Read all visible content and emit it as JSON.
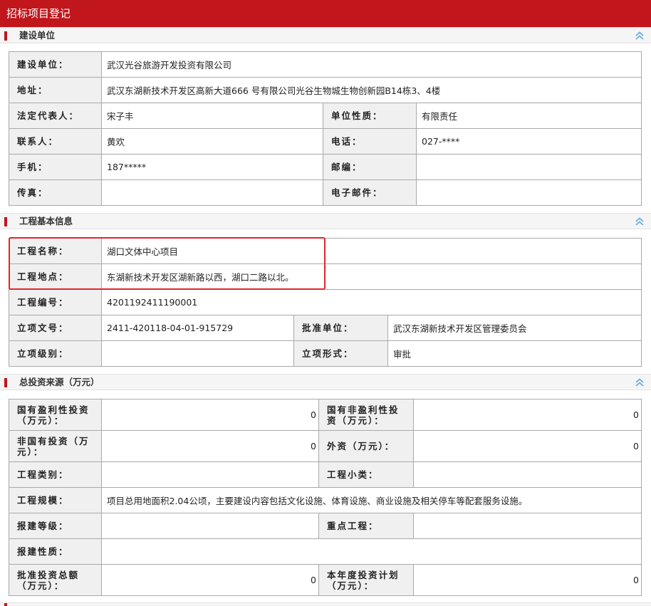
{
  "window": {
    "title": "招标项目登记"
  },
  "sections": {
    "builder": {
      "title": "建设单位",
      "rows": {
        "unit_label": "建设单位：",
        "unit_value": "武汉光谷旅游开发投资有限公司",
        "address_label": "地址：",
        "address_value": "武汉东湖新技术开发区高新大道666 号有限公司光谷生物城生物创新园B14栋3、4楼",
        "legal_rep_label": "法定代表人：",
        "legal_rep_value": "宋子丰",
        "unit_nature_label": "单位性质：",
        "unit_nature_value": "有限责任",
        "contact_label": "联系人：",
        "contact_value": "黄欢",
        "phone_label": "电话：",
        "phone_value": "027-****",
        "mobile_label": "手机：",
        "mobile_value": "187*****",
        "postcode_label": "邮编：",
        "postcode_value": "",
        "fax_label": "传真：",
        "fax_value": "",
        "email_label": "电子邮件：",
        "email_value": ""
      }
    },
    "project": {
      "title": "工程基本信息",
      "rows": {
        "name_label": "工程名称：",
        "name_value": "湖口文体中心项目",
        "location_label": "工程地点：",
        "location_value": "东湖新技术开发区湖新路以西，湖口二路以北。",
        "code_label": "工程编号：",
        "code_value": "4201192411190001",
        "doc_label": "立项文号：",
        "doc_value": "2411-420118-04-01-915729",
        "approver_label": "批准单位：",
        "approver_value": "武汉东湖新技术开发区管理委员会",
        "level_label": "立项级别：",
        "level_value": "",
        "form_label": "立项形式：",
        "form_value": "审批"
      }
    },
    "investment": {
      "title": "总投资来源（万元）",
      "rows": {
        "state_profit_label": "国有盈利性投资（万元）：",
        "state_profit_value": "0",
        "state_nonprofit_label": "国有非盈利性投资（万元）：",
        "state_nonprofit_value": "0",
        "nonstate_label": "非国有投资（万元）：",
        "nonstate_value": "0",
        "foreign_label": "外资（万元）：",
        "foreign_value": "0",
        "category_label": "工程类别：",
        "category_value": "",
        "subcategory_label": "工程小类：",
        "subcategory_value": "",
        "scale_label": "工程规模：",
        "scale_value": "项目总用地面积2.04公顷，主要建设内容包括文化设施、体育设施、商业设施及相关停车等配套服务设施。",
        "grade_label": "报建等级：",
        "grade_value": "",
        "key_label": "重点工程：",
        "key_value": "",
        "nature_label": "报建性质：",
        "nature_value": "",
        "approved_total_label": "批准投资总额（万元）：",
        "approved_total_value": "0",
        "year_plan_label": "本年度投资计划（万元）：",
        "year_plan_value": "0"
      }
    }
  },
  "colors": {
    "accent": "#c0161c",
    "highlight": "#e3262c",
    "label_bg": "#f0f0f0",
    "chevron": "#6aaee0"
  },
  "icons": {
    "collapse": "double-chevron-up-icon"
  }
}
